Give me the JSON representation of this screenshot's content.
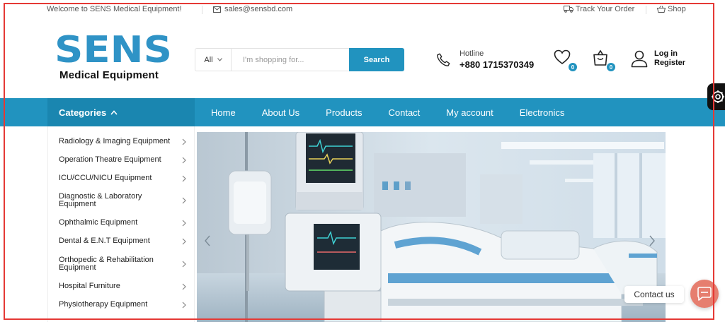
{
  "topbar": {
    "welcome": "Welcome to SENS Medical Equipment!",
    "email": "sales@sensbd.com",
    "track": "Track Your Order",
    "shop": "Shop"
  },
  "logo": {
    "word": "SENS",
    "tagline": "Medical Equipment",
    "color": "#2f93c6"
  },
  "search": {
    "category": "All",
    "placeholder": "I'm shopping for...",
    "button": "Search"
  },
  "hotline": {
    "label": "Hotline",
    "number": "+880 1715370349"
  },
  "wishlist": {
    "count": "0"
  },
  "cart": {
    "count": "0"
  },
  "account": {
    "login": "Log in",
    "register": "Register"
  },
  "nav": {
    "categories": "Categories",
    "items": [
      "Home",
      "About Us",
      "Products",
      "Contact",
      "My account",
      "Electronics"
    ]
  },
  "sidebar": {
    "items": [
      "Radiology & Imaging Equipment",
      "Operation Theatre Equipment",
      "ICU/CCU/NICU Equipment",
      "Diagnostic & Laboratory Equipment",
      "Ophthalmic Equipment",
      "Dental & E.N.T Equipment",
      "Orthopedic & Rehabilitation Equipment",
      "Hospital Furniture",
      "Physiotherapy Equipment"
    ]
  },
  "contact": {
    "label": "Contact us"
  },
  "colors": {
    "primary": "#2193bf",
    "accent": "#e67e6f"
  }
}
